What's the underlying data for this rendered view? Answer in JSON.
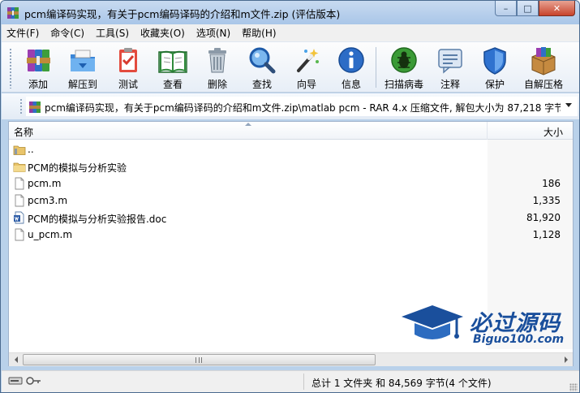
{
  "window": {
    "title": "pcm编译码实现，有关于pcm编码译码的介绍和m文件.zip (评估版本)",
    "controls": {
      "minimize": "–",
      "maximize": "□",
      "close": "✕"
    }
  },
  "menu": [
    "文件(F)",
    "命令(C)",
    "工具(S)",
    "收藏夹(O)",
    "选项(N)",
    "帮助(H)"
  ],
  "toolbar": {
    "buttons": [
      {
        "label": "添加",
        "icon": "add-books-icon"
      },
      {
        "label": "解压到",
        "icon": "extract-folder-icon"
      },
      {
        "label": "测试",
        "icon": "test-clipboard-icon"
      },
      {
        "label": "查看",
        "icon": "view-book-icon"
      },
      {
        "label": "删除",
        "icon": "trash-icon"
      },
      {
        "label": "查找",
        "icon": "magnifier-icon"
      },
      {
        "label": "向导",
        "icon": "wizard-wand-icon"
      },
      {
        "label": "信息",
        "icon": "info-icon"
      },
      {
        "label": "扫描病毒",
        "icon": "virus-scan-icon"
      },
      {
        "label": "注释",
        "icon": "comment-icon"
      },
      {
        "label": "保护",
        "icon": "shield-icon"
      },
      {
        "label": "自解压格",
        "icon": "sfx-box-icon"
      }
    ]
  },
  "address": {
    "text": "pcm编译码实现，有关于pcm编码译码的介绍和m文件.zip\\matlab pcm - RAR 4.x 压缩文件, 解包大小为 87,218 字节"
  },
  "columns": {
    "name": "名称",
    "size": "大小"
  },
  "files": [
    {
      "name": "..",
      "size": "",
      "icon": "parent-folder-icon"
    },
    {
      "name": "PCM的模拟与分析实验",
      "size": "",
      "icon": "folder-icon"
    },
    {
      "name": "pcm.m",
      "size": "186",
      "icon": "file-icon"
    },
    {
      "name": "pcm3.m",
      "size": "1,335",
      "icon": "file-icon"
    },
    {
      "name": "PCM的模拟与分析实验报告.doc",
      "size": "81,920",
      "icon": "word-doc-icon"
    },
    {
      "name": "u_pcm.m",
      "size": "1,128",
      "icon": "file-icon"
    }
  ],
  "watermark": {
    "title": "必过源码",
    "subtitle": "Biguo100.com"
  },
  "status": {
    "text": "总计 1 文件夹 和 84,569 字节(4 个文件)"
  },
  "colors": {
    "title_bar": "#b9d1ea",
    "watermark_blue": "#1a4f9c"
  }
}
